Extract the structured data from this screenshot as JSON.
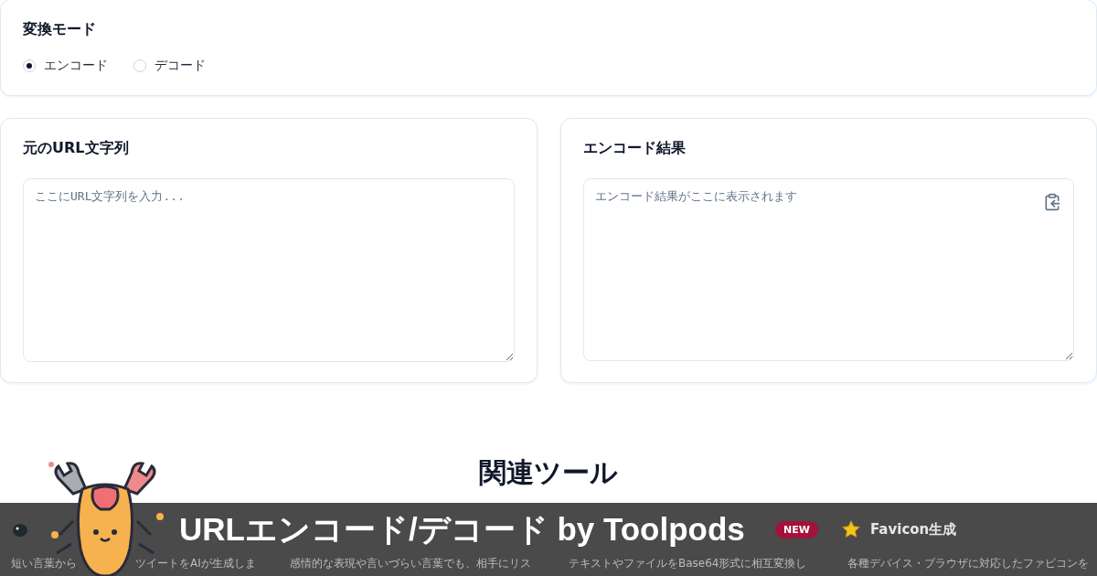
{
  "mode_panel": {
    "title": "変換モード",
    "options": [
      {
        "label": "エンコード",
        "selected": true
      },
      {
        "label": "デコード",
        "selected": false
      }
    ]
  },
  "input_panel": {
    "title": "元のURL文字列",
    "placeholder": "ここにURL文字列を入力..."
  },
  "output_panel": {
    "title": "エンコード結果",
    "placeholder": "エンコード結果がここに表示されます"
  },
  "related": {
    "title": "関連ツール",
    "tools": [
      {
        "kind": "bird",
        "description": "短い言葉から",
        "description_tail": "ツイートをAIが生成しま"
      },
      {
        "kind": "none",
        "description": "感情的な表現や言いづらい言葉でも、相手にリス"
      },
      {
        "kind": "none",
        "badge": "NEW",
        "description": "テキストやファイルをBase64形式に相互変換し"
      },
      {
        "kind": "star",
        "title": "Favicon生成",
        "description": "各種デバイス・ブラウザに対応したファビコンを"
      }
    ]
  },
  "banner": {
    "title": "URLエンコード/デコード by Toolpods"
  }
}
